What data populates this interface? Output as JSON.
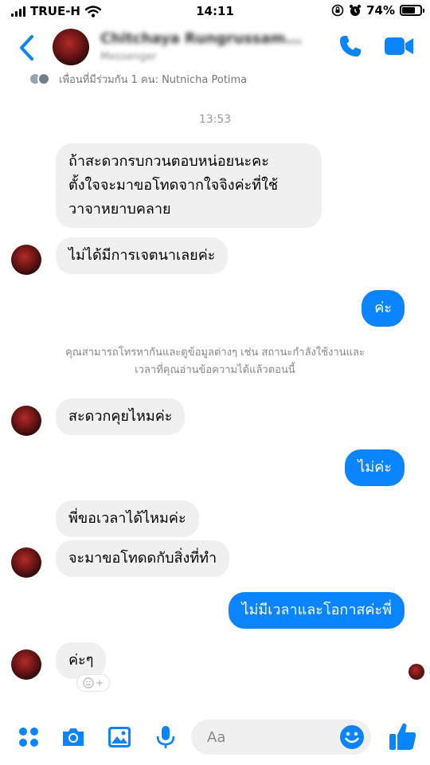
{
  "status_bar": {
    "carrier": "TRUE-H",
    "time": "14:11",
    "battery_percent_label": "74%",
    "battery_level": 0.74
  },
  "header": {
    "contact_name": "Chitchaya Rungrussam...",
    "contact_subtitle": "Messenger"
  },
  "mutual_friends": "เพื่อนที่มีร่วมกัน 1 คน: Nutnicha Potima",
  "timestamp": "13:53",
  "messages": [
    {
      "from": "them",
      "lines": [
        "ถ้าสะดวกรบกวนตอบหน่อยนะคะ",
        "ตั้งใจจะมาขอโทดจากใจจิงค่ะที่ใช้",
        "วาจาหยาบคลาย"
      ]
    },
    {
      "from": "them",
      "text": "ไม่ได้มีการเจตนาเลยค่ะ"
    },
    {
      "from": "me",
      "text": "ค่ะ"
    },
    {
      "from": "them",
      "text": "สะดวกคุยไหมค่ะ"
    },
    {
      "from": "me",
      "text": "ไม่ค่ะ"
    },
    {
      "from": "them",
      "text": "พี่ขอเวลาได้ไหมค่ะ"
    },
    {
      "from": "them",
      "text": "จะมาขอโทดดกับสิ่งที่ทำ"
    },
    {
      "from": "me",
      "text": "ไม่มีเวลาและโอกาสค่ะพี่"
    },
    {
      "from": "them",
      "text": "ค่ะๆ"
    }
  ],
  "system_message": {
    "line1": "คุณสามารถโทรหากันและดูข้อมูลต่างๆ เช่น สถานะกำลังใช้งานและ",
    "line2": "เวลาที่คุณอ่านข้อความได้แล้วตอนนี้"
  },
  "react_button_label": "+",
  "composer": {
    "placeholder": "Aa"
  },
  "colors": {
    "accent": "#0a84ff",
    "incoming_bubble": "#f0f0f0",
    "meta_text": "#9a9a9a"
  },
  "icons": [
    "signal-icon",
    "wifi-icon",
    "orientation-lock-icon",
    "alarm-icon",
    "battery-icon",
    "back-chevron-icon",
    "phone-icon",
    "video-camera-icon",
    "apps-grid-icon",
    "camera-icon",
    "gallery-icon",
    "microphone-icon",
    "emoji-icon",
    "thumbs-up-icon"
  ]
}
